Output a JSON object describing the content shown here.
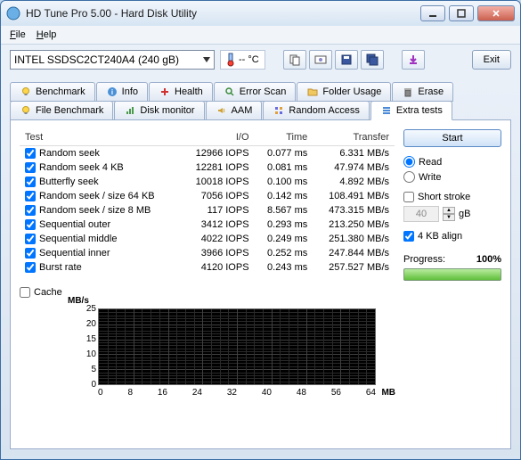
{
  "window": {
    "title": "HD Tune Pro 5.00 - Hard Disk Utility"
  },
  "menu": {
    "file": "File",
    "help": "Help"
  },
  "toolbar": {
    "drive": "INTEL SSDSC2CT240A4 (240 gB)",
    "temp": "-- °C",
    "exit": "Exit"
  },
  "tabs": {
    "row1": [
      {
        "label": "Benchmark",
        "icon": "bulb"
      },
      {
        "label": "Info",
        "icon": "info"
      },
      {
        "label": "Health",
        "icon": "plus"
      },
      {
        "label": "Error Scan",
        "icon": "search"
      },
      {
        "label": "Folder Usage",
        "icon": "folder"
      },
      {
        "label": "Erase",
        "icon": "trash"
      }
    ],
    "row2": [
      {
        "label": "File Benchmark",
        "icon": "bulb2"
      },
      {
        "label": "Disk monitor",
        "icon": "chart"
      },
      {
        "label": "AAM",
        "icon": "speaker"
      },
      {
        "label": "Random Access",
        "icon": "rand"
      },
      {
        "label": "Extra tests",
        "icon": "list",
        "active": true
      }
    ]
  },
  "table": {
    "headers": [
      "Test",
      "I/O",
      "Time",
      "Transfer"
    ],
    "rows": [
      {
        "name": "Random seek",
        "io": "12966 IOPS",
        "time": "0.077 ms",
        "transfer": "6.331 MB/s"
      },
      {
        "name": "Random seek 4 KB",
        "io": "12281 IOPS",
        "time": "0.081 ms",
        "transfer": "47.974 MB/s"
      },
      {
        "name": "Butterfly seek",
        "io": "10018 IOPS",
        "time": "0.100 ms",
        "transfer": "4.892 MB/s"
      },
      {
        "name": "Random seek / size 64 KB",
        "io": "7056 IOPS",
        "time": "0.142 ms",
        "transfer": "108.491 MB/s"
      },
      {
        "name": "Random seek / size 8 MB",
        "io": "117 IOPS",
        "time": "8.567 ms",
        "transfer": "473.315 MB/s"
      },
      {
        "name": "Sequential outer",
        "io": "3412 IOPS",
        "time": "0.293 ms",
        "transfer": "213.250 MB/s"
      },
      {
        "name": "Sequential middle",
        "io": "4022 IOPS",
        "time": "0.249 ms",
        "transfer": "251.380 MB/s"
      },
      {
        "name": "Sequential inner",
        "io": "3966 IOPS",
        "time": "0.252 ms",
        "transfer": "247.844 MB/s"
      },
      {
        "name": "Burst rate",
        "io": "4120 IOPS",
        "time": "0.243 ms",
        "transfer": "257.527 MB/s"
      }
    ]
  },
  "cache_label": "Cache",
  "side": {
    "start": "Start",
    "read": "Read",
    "write": "Write",
    "short_stroke": "Short stroke",
    "stroke_val": "40",
    "stroke_unit": "gB",
    "align": "4 KB align",
    "progress_label": "Progress:",
    "progress_value": "100%"
  },
  "chart_data": {
    "type": "line",
    "yunit": "MB/s",
    "xunit": "MB",
    "yticks": [
      "25",
      "20",
      "15",
      "10",
      "5",
      "0"
    ],
    "xticks": [
      "0",
      "8",
      "16",
      "24",
      "32",
      "40",
      "48",
      "56",
      "64"
    ],
    "ylim": [
      0,
      25
    ],
    "xlim": [
      0,
      64
    ],
    "series": []
  }
}
